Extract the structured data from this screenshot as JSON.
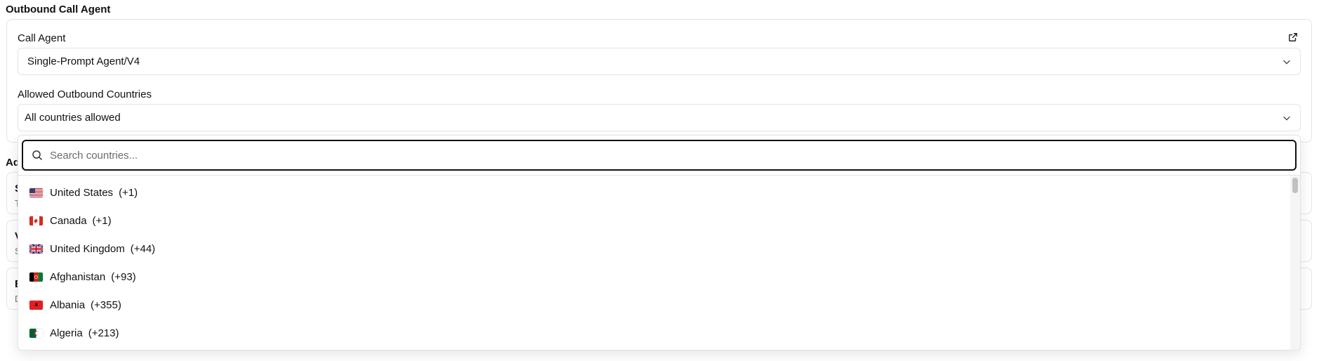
{
  "section": {
    "title": "Outbound Call Agent"
  },
  "call_agent": {
    "label": "Call Agent",
    "value": "Single-Prompt Agent/V4",
    "external_link_icon": "external-link-icon",
    "chevron_icon": "chevron-down-icon"
  },
  "countries": {
    "label": "Allowed Outbound Countries",
    "value": "All countries allowed",
    "chevron_icon": "chevron-down-icon"
  },
  "background": {
    "section_title_partial": "Ad",
    "cards": [
      {
        "title_partial": "S",
        "desc_partial": "T"
      },
      {
        "title_partial": "V",
        "desc_partial": "S"
      },
      {
        "title_partial": "E",
        "desc_partial": "D"
      }
    ]
  },
  "dropdown": {
    "search_placeholder": "Search countries...",
    "search_value": "",
    "search_icon": "search-icon",
    "items": [
      {
        "name": "United States",
        "code": "(+1)",
        "flag": "us"
      },
      {
        "name": "Canada",
        "code": "(+1)",
        "flag": "ca"
      },
      {
        "name": "United Kingdom",
        "code": "(+44)",
        "flag": "gb"
      },
      {
        "name": "Afghanistan",
        "code": "(+93)",
        "flag": "af"
      },
      {
        "name": "Albania",
        "code": "(+355)",
        "flag": "al"
      },
      {
        "name": "Algeria",
        "code": "(+213)",
        "flag": "dz"
      }
    ]
  },
  "colors": {
    "border": "#e4e4e7",
    "focus_border": "#111111",
    "text": "#111111",
    "muted": "#71717a"
  }
}
